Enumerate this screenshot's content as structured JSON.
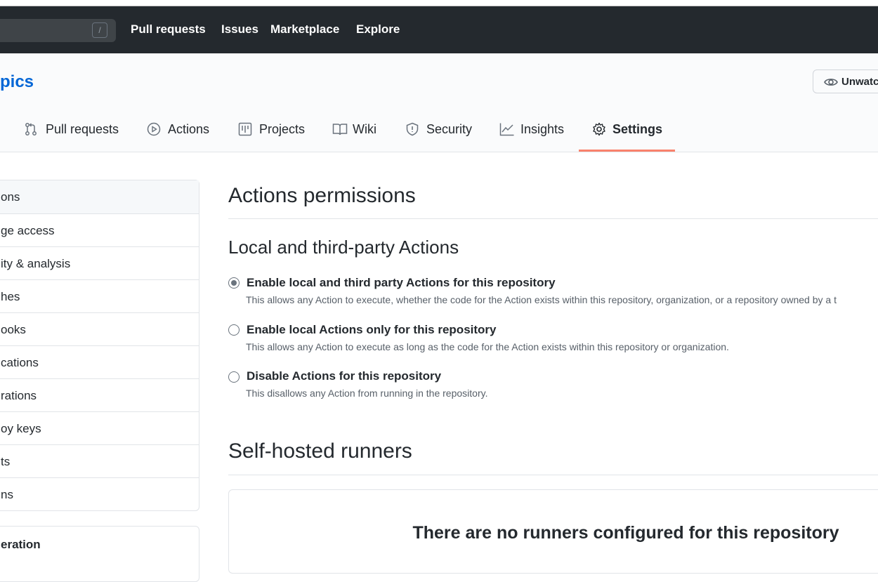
{
  "header": {
    "search_shortcut": "/",
    "nav": [
      "Pull requests",
      "Issues",
      "Marketplace",
      "Explore"
    ]
  },
  "repo": {
    "name_fragment": "pics",
    "watch_label": "Unwatch"
  },
  "tabs": [
    {
      "label": "Pull requests",
      "icon": "pull-request-icon"
    },
    {
      "label": "Actions",
      "icon": "play-icon"
    },
    {
      "label": "Projects",
      "icon": "project-icon"
    },
    {
      "label": "Wiki",
      "icon": "book-icon"
    },
    {
      "label": "Security",
      "icon": "shield-icon"
    },
    {
      "label": "Insights",
      "icon": "graph-icon"
    },
    {
      "label": "Settings",
      "icon": "gear-icon",
      "selected": true
    }
  ],
  "sidebar": {
    "items": [
      "ons",
      "ge access",
      "ity & analysis",
      "hes",
      "ooks",
      "cations",
      "rations",
      "oy keys",
      "ts",
      "ns"
    ],
    "section2_title": "eration"
  },
  "main": {
    "title": "Actions permissions",
    "subtitle": "Local and third-party Actions",
    "options": [
      {
        "label": "Enable local and third party Actions for this repository",
        "desc": "This allows any Action to execute, whether the code for the Action exists within this repository, organization, or a repository owned by a t",
        "checked": true
      },
      {
        "label": "Enable local Actions only for this repository",
        "desc": "This allows any Action to execute as long as the code for the Action exists within this repository or organization.",
        "checked": false
      },
      {
        "label": "Disable Actions for this repository",
        "desc": "This disallows any Action from running in the repository.",
        "checked": false
      }
    ],
    "runners_title": "Self-hosted runners",
    "runners_empty": "There are no runners configured for this repository"
  },
  "colors": {
    "header_bg": "#24292e",
    "link": "#0366d6",
    "tab_underline": "#f9826c"
  }
}
